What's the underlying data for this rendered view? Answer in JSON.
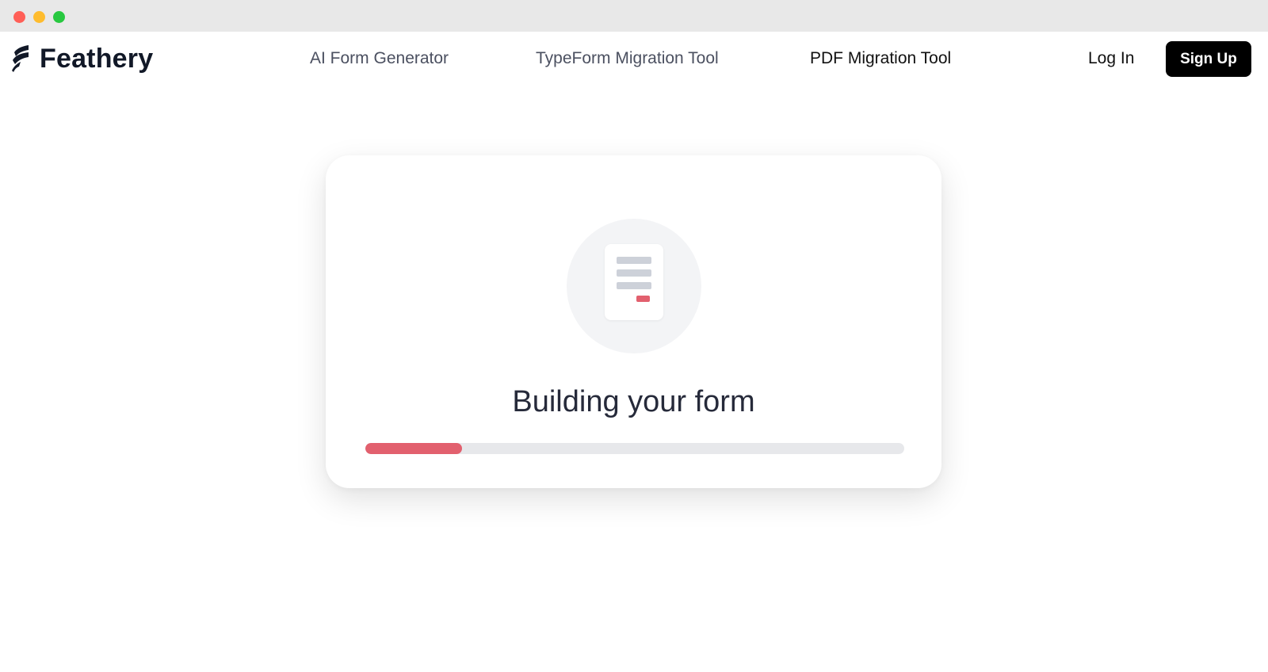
{
  "window": {
    "controls": [
      "close",
      "minimize",
      "maximize"
    ]
  },
  "brand": {
    "name": "Feathery",
    "logo_icon": "feather-logo-icon"
  },
  "nav": {
    "items": [
      {
        "label": "AI Form Generator",
        "active": false
      },
      {
        "label": "TypeForm Migration Tool",
        "active": false
      },
      {
        "label": "PDF Migration Tool",
        "active": true
      }
    ],
    "login_label": "Log In",
    "signup_label": "Sign Up"
  },
  "card": {
    "icon": "document-icon",
    "title": "Building your form",
    "progress_percent": 18
  },
  "colors": {
    "accent": "#e2606e",
    "button_bg": "#000000",
    "track": "#e7e8eb",
    "illustration_bg": "#f3f4f6"
  }
}
